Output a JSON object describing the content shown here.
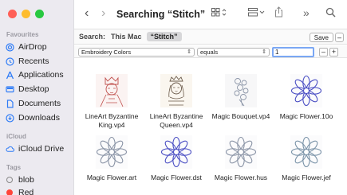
{
  "window": {
    "title": "Searching “Stitch”"
  },
  "sidebar": {
    "favourites_label": "Favourites",
    "favourites": [
      {
        "label": "AirDrop",
        "icon": "airdrop-icon"
      },
      {
        "label": "Recents",
        "icon": "clock-icon"
      },
      {
        "label": "Applications",
        "icon": "applications-icon"
      },
      {
        "label": "Desktop",
        "icon": "desktop-icon"
      },
      {
        "label": "Documents",
        "icon": "document-icon"
      },
      {
        "label": "Downloads",
        "icon": "download-icon"
      }
    ],
    "icloud_label": "iCloud",
    "icloud": [
      {
        "label": "iCloud Drive",
        "icon": "cloud-icon"
      }
    ],
    "tags_label": "Tags",
    "tags": [
      {
        "label": "blob",
        "color": "#ffffff"
      },
      {
        "label": "Red",
        "color": "#ff453a"
      }
    ]
  },
  "toolbar": {
    "back_icon": "chevron-left-icon",
    "forward_icon": "chevron-right-icon",
    "view_icon": "grid-view-icon",
    "group_icon": "group-icon",
    "share_icon": "share-icon",
    "more_icon": "more-icon",
    "search_icon": "search-icon"
  },
  "search": {
    "label": "Search:",
    "scope_this_mac": "This Mac",
    "scope_query": "“Stitch”",
    "save_label": "Save",
    "minus_label": "–"
  },
  "criteria": {
    "attribute": "Embroidery Colors",
    "operator": "equals",
    "value": "1",
    "minus_label": "–",
    "plus_label": "+"
  },
  "files": [
    {
      "name": "LineArt Byzantine King.vp4",
      "kind": "king"
    },
    {
      "name": "LineArt Byzantine Queen.vp4",
      "kind": "queen"
    },
    {
      "name": "Magic Bouquet.vp4",
      "kind": "bouquet"
    },
    {
      "name": "Magic Flower.10o",
      "kind": "flower"
    },
    {
      "name": "Magic Flower.art",
      "kind": "flower-grey"
    },
    {
      "name": "Magic Flower.dst",
      "kind": "flower"
    },
    {
      "name": "Magic Flower.hus",
      "kind": "flower-grey"
    },
    {
      "name": "Magic Flower.jef",
      "kind": "flower-grey"
    }
  ],
  "colors": {
    "accent": "#2f7cf6",
    "flower": "#4b4fc4",
    "flower_grey": "#8a94a6",
    "king": "#c0504d"
  }
}
